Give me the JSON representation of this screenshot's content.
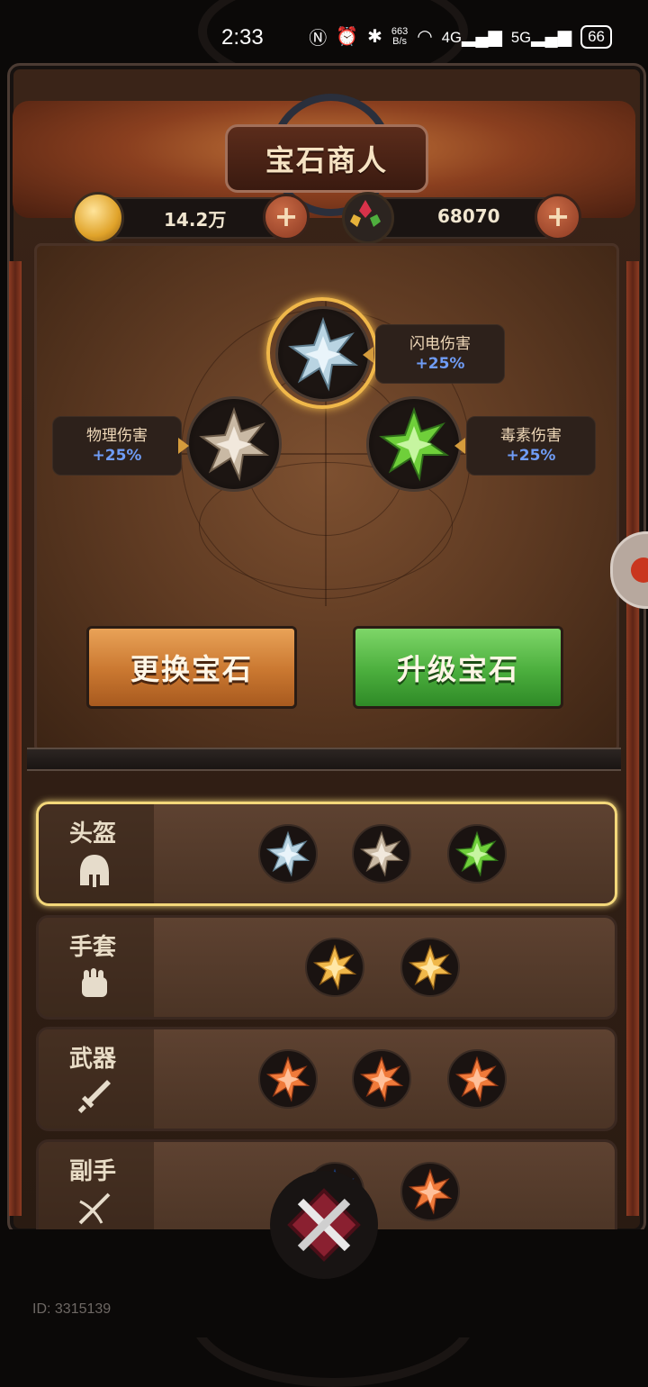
{
  "status_bar": {
    "time": "2:33",
    "net_speed_top": "663",
    "net_speed_bottom": "B/s",
    "signal_a": "4G",
    "signal_b": "5G",
    "battery": "66"
  },
  "header": {
    "title": "宝石商人",
    "coins": "14.2万",
    "gems": "68070",
    "plus_symbol": "+"
  },
  "gem_panel": {
    "top": {
      "name": "闪电伤害",
      "bonus": "+25%",
      "gem": "silver-blue",
      "selected": true
    },
    "left": {
      "name": "物理伤害",
      "bonus": "+25%",
      "gem": "bronze-white"
    },
    "right": {
      "name": "毒素伤害",
      "bonus": "+25%",
      "gem": "green"
    },
    "change_button": "更换宝石",
    "upgrade_button": "升级宝石"
  },
  "equipment_rows": [
    {
      "label": "头盔",
      "icon": "helmet-icon",
      "selected": true,
      "gems": [
        "silver-blue",
        "bronze-white",
        "green"
      ]
    },
    {
      "label": "手套",
      "icon": "glove-icon",
      "selected": false,
      "gems": [
        "gold",
        "gold"
      ]
    },
    {
      "label": "武器",
      "icon": "sword-icon",
      "selected": false,
      "gems": [
        "orange",
        "orange",
        "orange"
      ]
    },
    {
      "label": "副手",
      "icon": "crossbow-icon",
      "selected": false,
      "gems": [
        "blue",
        "orange"
      ]
    }
  ],
  "footer": {
    "id_text": "ID: 3315139"
  },
  "colors": {
    "accent_gold": "#f0b84a",
    "bonus_blue": "#6f9cf5",
    "upgrade_green": "#4bae3d",
    "change_orange": "#c97730"
  }
}
